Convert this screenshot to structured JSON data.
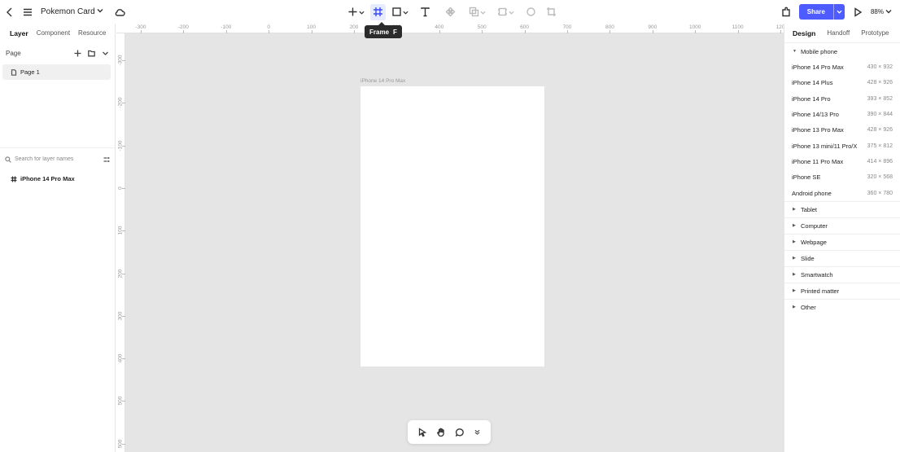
{
  "header": {
    "doc_title": "Pokemon Card",
    "share_label": "Share",
    "zoom": "88%"
  },
  "tooltip": {
    "label": "Frame",
    "shortcut": "F"
  },
  "left_panel": {
    "tabs": [
      "Layer",
      "Component",
      "Resource"
    ],
    "page_section_label": "Page",
    "pages": [
      "Page 1"
    ],
    "search_placeholder": "Search for layer names",
    "layers": [
      "iPhone 14 Pro Max"
    ]
  },
  "canvas": {
    "ruler_top": [
      "-300",
      "-200",
      "-100",
      "0",
      "100",
      "200",
      "300",
      "400",
      "500",
      "600",
      "700",
      "800",
      "900",
      "1000",
      "1100",
      "120"
    ],
    "ruler_left": [
      "-300",
      "-200",
      "-100",
      "0",
      "100",
      "200",
      "300",
      "400",
      "500",
      "500"
    ],
    "frame_label": "iPhone 14 Pro Max"
  },
  "help_label": "?",
  "right_panel": {
    "tabs": [
      "Design",
      "Handoff",
      "Prototype"
    ],
    "open_category": "Mobile phone",
    "devices": [
      {
        "name": "iPhone 14 Pro Max",
        "size": "430 × 932"
      },
      {
        "name": "iPhone 14 Plus",
        "size": "428 × 926"
      },
      {
        "name": "iPhone 14 Pro",
        "size": "393 × 852"
      },
      {
        "name": "iPhone 14/13 Pro",
        "size": "390 × 844"
      },
      {
        "name": "iPhone 13 Pro Max",
        "size": "428 × 926"
      },
      {
        "name": "iPhone 13 mini/11 Pro/X",
        "size": "375 × 812"
      },
      {
        "name": "iPhone 11 Pro Max",
        "size": "414 × 896"
      },
      {
        "name": "iPhone SE",
        "size": "320 × 568"
      },
      {
        "name": "Android phone",
        "size": "360 × 780"
      }
    ],
    "categories": [
      "Tablet",
      "Computer",
      "Webpage",
      "Slide",
      "Smartwatch",
      "Printed matter",
      "Other"
    ]
  },
  "colors": {
    "accent": "#4d5bff",
    "canvas_bg": "#e5e5e5",
    "tool_active_bg": "#e6ebff"
  },
  "icons": [
    "back-icon",
    "menu-icon",
    "cloud-icon",
    "plus-icon",
    "frame-icon",
    "rectangle-icon",
    "text-icon",
    "component-icon",
    "boolean-icon",
    "mask-icon",
    "circle-icon",
    "crop-icon",
    "plugin-icon",
    "play-icon",
    "pointer-icon",
    "hand-icon",
    "comment-icon",
    "expand-icon"
  ]
}
